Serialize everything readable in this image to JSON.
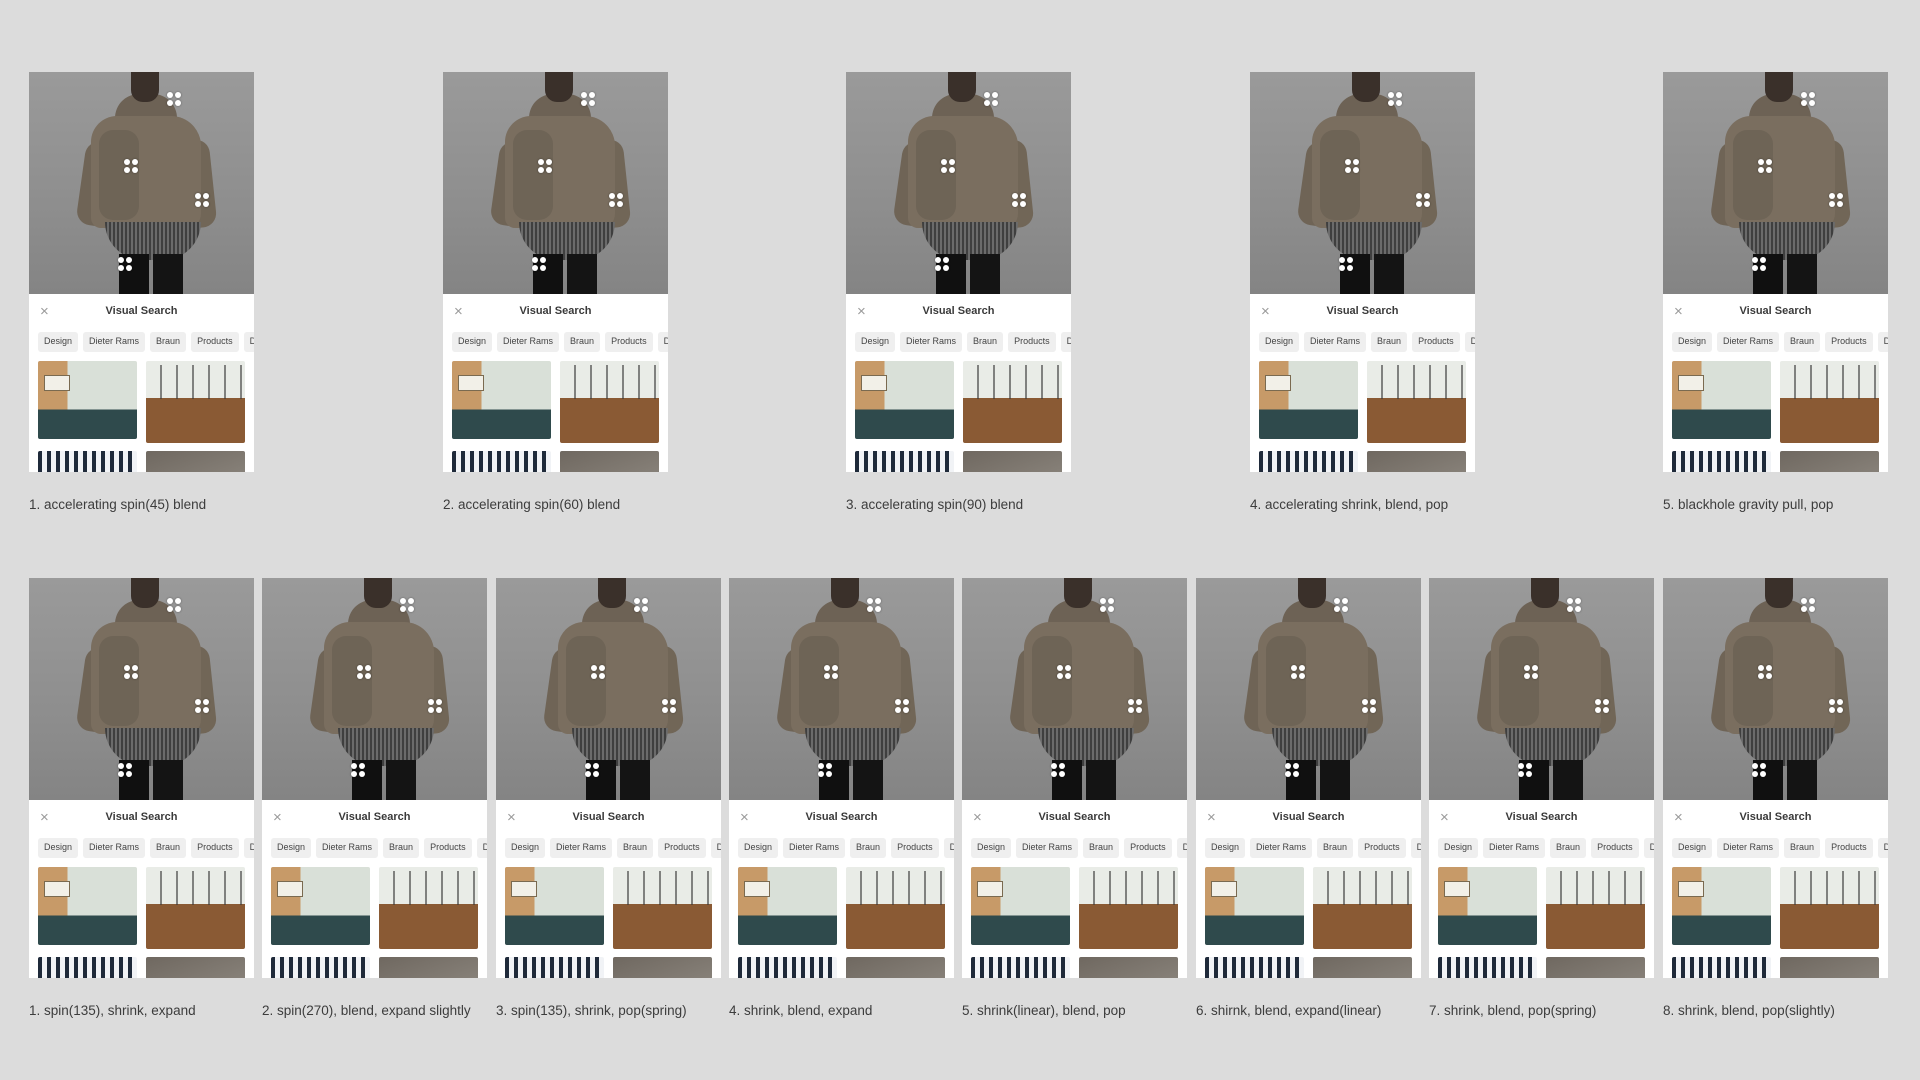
{
  "common": {
    "sheet_title": "Visual Search",
    "close_glyph": "×",
    "chips": [
      "Design",
      "Dieter Rams",
      "Braun",
      "Products",
      "Design"
    ]
  },
  "rows": [
    {
      "variants": [
        {
          "caption": "1. accelerating spin(45) blend"
        },
        {
          "caption": "2. accelerating spin(60) blend"
        },
        {
          "caption": "3. accelerating spin(90) blend"
        },
        {
          "caption": "4. accelerating shrink, blend, pop"
        },
        {
          "caption": "5. blackhole gravity pull, pop"
        }
      ]
    },
    {
      "variants": [
        {
          "caption": "1. spin(135), shrink, expand"
        },
        {
          "caption": "2. spin(270), blend, expand slightly"
        },
        {
          "caption": "3. spin(135), shrink, pop(spring)"
        },
        {
          "caption": "4. shrink, blend, expand"
        },
        {
          "caption": "5. shrink(linear), blend, pop"
        },
        {
          "caption": "6. shirnk, blend, expand(linear)"
        },
        {
          "caption": "7. shrink, blend, pop(spring)"
        },
        {
          "caption": "8. shrink, blend, pop(slightly)"
        }
      ]
    }
  ]
}
